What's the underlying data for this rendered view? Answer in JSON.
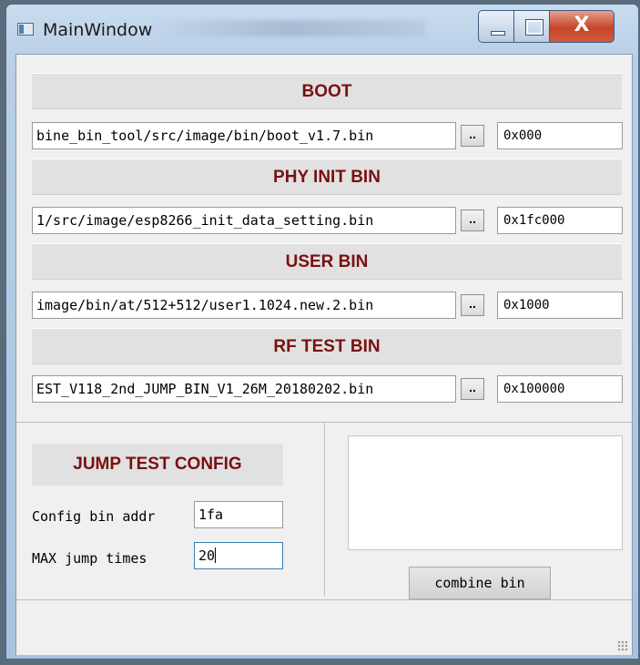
{
  "window": {
    "title": "MainWindow",
    "close_glyph": "X",
    "icons": {
      "app": "window-app-icon",
      "minimize": "minimize-icon",
      "maximize": "maximize-icon",
      "close": "close-icon"
    }
  },
  "sections": [
    {
      "header": "BOOT",
      "path": "bine_bin_tool/src/image/bin/boot_v1.7.bin",
      "browse": "..",
      "addr": "0x000"
    },
    {
      "header": "PHY INIT BIN",
      "path": "1/src/image/esp8266_init_data_setting.bin",
      "browse": "..",
      "addr": "0x1fc000"
    },
    {
      "header": "USER BIN",
      "path": "image/bin/at/512+512/user1.1024.new.2.bin",
      "browse": "..",
      "addr": "0x1000"
    },
    {
      "header": "RF TEST BIN",
      "path": "EST_V118_2nd_JUMP_BIN_V1_26M_20180202.bin",
      "browse": "..",
      "addr": "0x100000"
    }
  ],
  "jump_test": {
    "title": "JUMP TEST CONFIG",
    "config_label": "Config bin addr",
    "config_value": "1fa",
    "max_label": "MAX jump times",
    "max_value": "20"
  },
  "actions": {
    "combine_label": "combine bin"
  },
  "colors": {
    "section_title": "#7a1010",
    "titlebar": "#b8cfe6",
    "close_button": "#c6452b"
  }
}
